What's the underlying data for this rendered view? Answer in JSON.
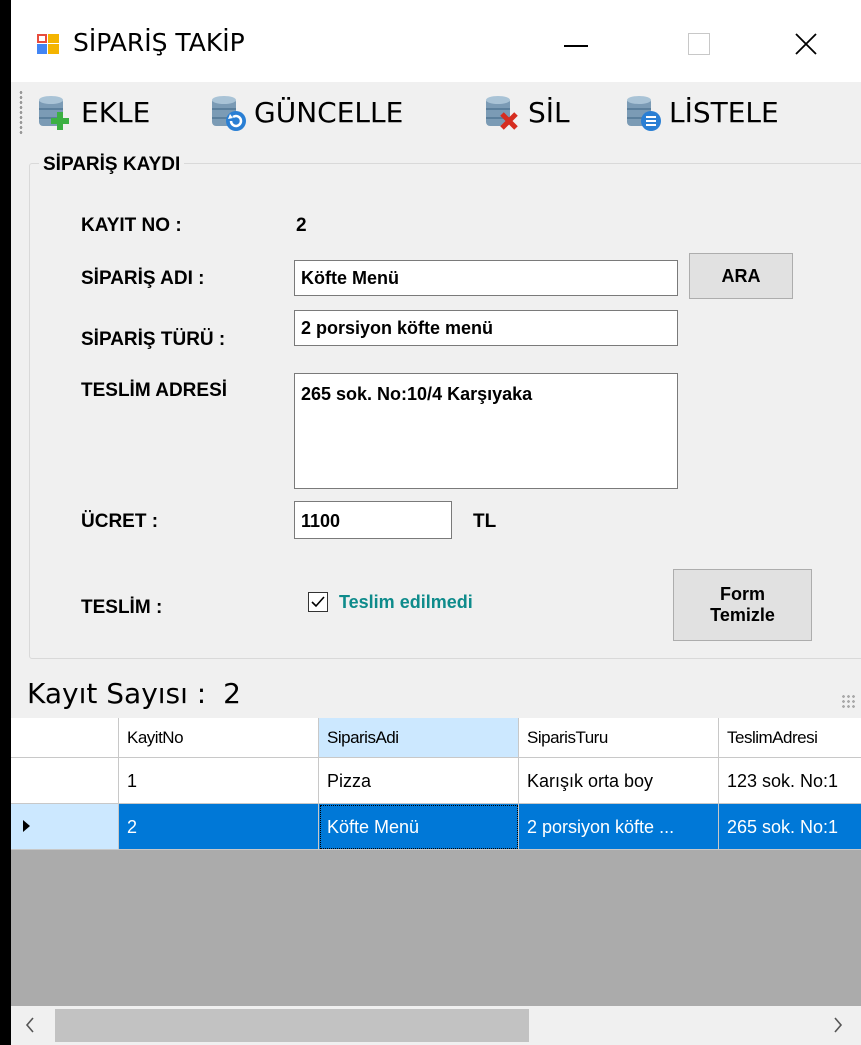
{
  "window": {
    "title": "SİPARİŞ TAKİP",
    "controls": {
      "minimize": "—",
      "maximize": "☐",
      "close": "✕"
    }
  },
  "toolbar": {
    "items": [
      {
        "label": "EKLE",
        "icon": "database-add-icon"
      },
      {
        "label": "GÜNCELLE",
        "icon": "database-refresh-icon"
      },
      {
        "label": "SİL",
        "icon": "database-delete-icon"
      },
      {
        "label": "LİSTELE",
        "icon": "database-list-icon"
      }
    ]
  },
  "form": {
    "group_title": "SİPARİŞ KAYDI",
    "kayit_no_label": "KAYIT NO :",
    "kayit_no_value": "2",
    "siparis_adi_label": "SİPARİŞ ADI :",
    "siparis_adi_value": "Köfte Menü",
    "ara_button": "ARA",
    "siparis_turu_label": "SİPARİŞ TÜRÜ :",
    "siparis_turu_value": "2 porsiyon köfte menü",
    "teslim_adresi_label": "TESLİM ADRESİ",
    "teslim_adresi_value": "265 sok. No:10/4 Karşıyaka",
    "ucret_label": "ÜCRET :",
    "ucret_value": "1100",
    "ucret_unit": "TL",
    "teslim_label": "TESLİM :",
    "teslim_checkbox_label": "Teslim edilmedi",
    "teslim_checked": true,
    "form_temizle_line1": "Form",
    "form_temizle_line2": "Temizle"
  },
  "status": {
    "kayit_sayisi_label": "Kayıt Sayısı :",
    "kayit_sayisi_value": "2"
  },
  "grid": {
    "columns": [
      "KayitNo",
      "SiparisAdi",
      "SiparisTuru",
      "TeslimAdresi"
    ],
    "rows": [
      {
        "cells": [
          "1",
          "Pizza",
          "Karışık orta boy",
          "123 sok. No:1"
        ]
      },
      {
        "cells": [
          "2",
          "Köfte Menü",
          "2 porsiyon köfte ...",
          "265 sok. No:1"
        ]
      }
    ],
    "selected_row": 2,
    "colors": {
      "selection": "#0078d7",
      "selected_header": "#cce8ff",
      "empty_area": "#ababab"
    }
  }
}
